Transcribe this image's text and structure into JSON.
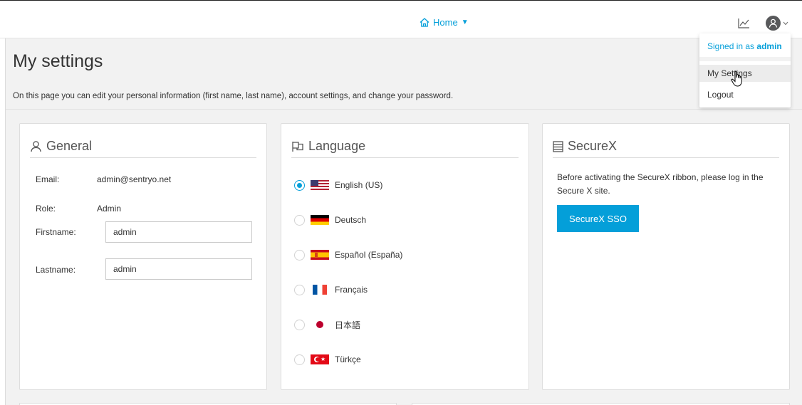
{
  "nav": {
    "home_label": "Home"
  },
  "page": {
    "title": "My settings",
    "description": "On this page you can edit your personal information (first name, last name), account settings, and change your password."
  },
  "general": {
    "title": "General",
    "email_label": "Email:",
    "email_value": "admin@sentryo.net",
    "role_label": "Role:",
    "role_value": "Admin",
    "firstname_label": "Firstname:",
    "firstname_value": "admin",
    "lastname_label": "Lastname:",
    "lastname_value": "admin"
  },
  "language": {
    "title": "Language",
    "selected": "English (US)",
    "options": [
      {
        "label": "English (US)",
        "flag": "us-flag",
        "checked": true
      },
      {
        "label": "Deutsch",
        "flag": "de-flag",
        "checked": false
      },
      {
        "label": "Español (España)",
        "flag": "es-flag",
        "checked": false
      },
      {
        "label": "Français",
        "flag": "fr-flag",
        "checked": false
      },
      {
        "label": "日本語",
        "flag": "jp-flag",
        "checked": false
      },
      {
        "label": "Türkçe",
        "flag": "tr-flag",
        "checked": false
      }
    ]
  },
  "securex": {
    "title": "SecureX",
    "text": "Before activating the SecureX ribbon, please log in the Secure X site.",
    "button_label": "SecureX SSO"
  },
  "user_menu": {
    "signed_in_prefix": "Signed in as",
    "username": "admin",
    "items": [
      "My Settings",
      "Logout"
    ]
  },
  "colors": {
    "accent": "#049fd9",
    "avatar": "#58595b",
    "page_bg": "#f2f2f2"
  }
}
